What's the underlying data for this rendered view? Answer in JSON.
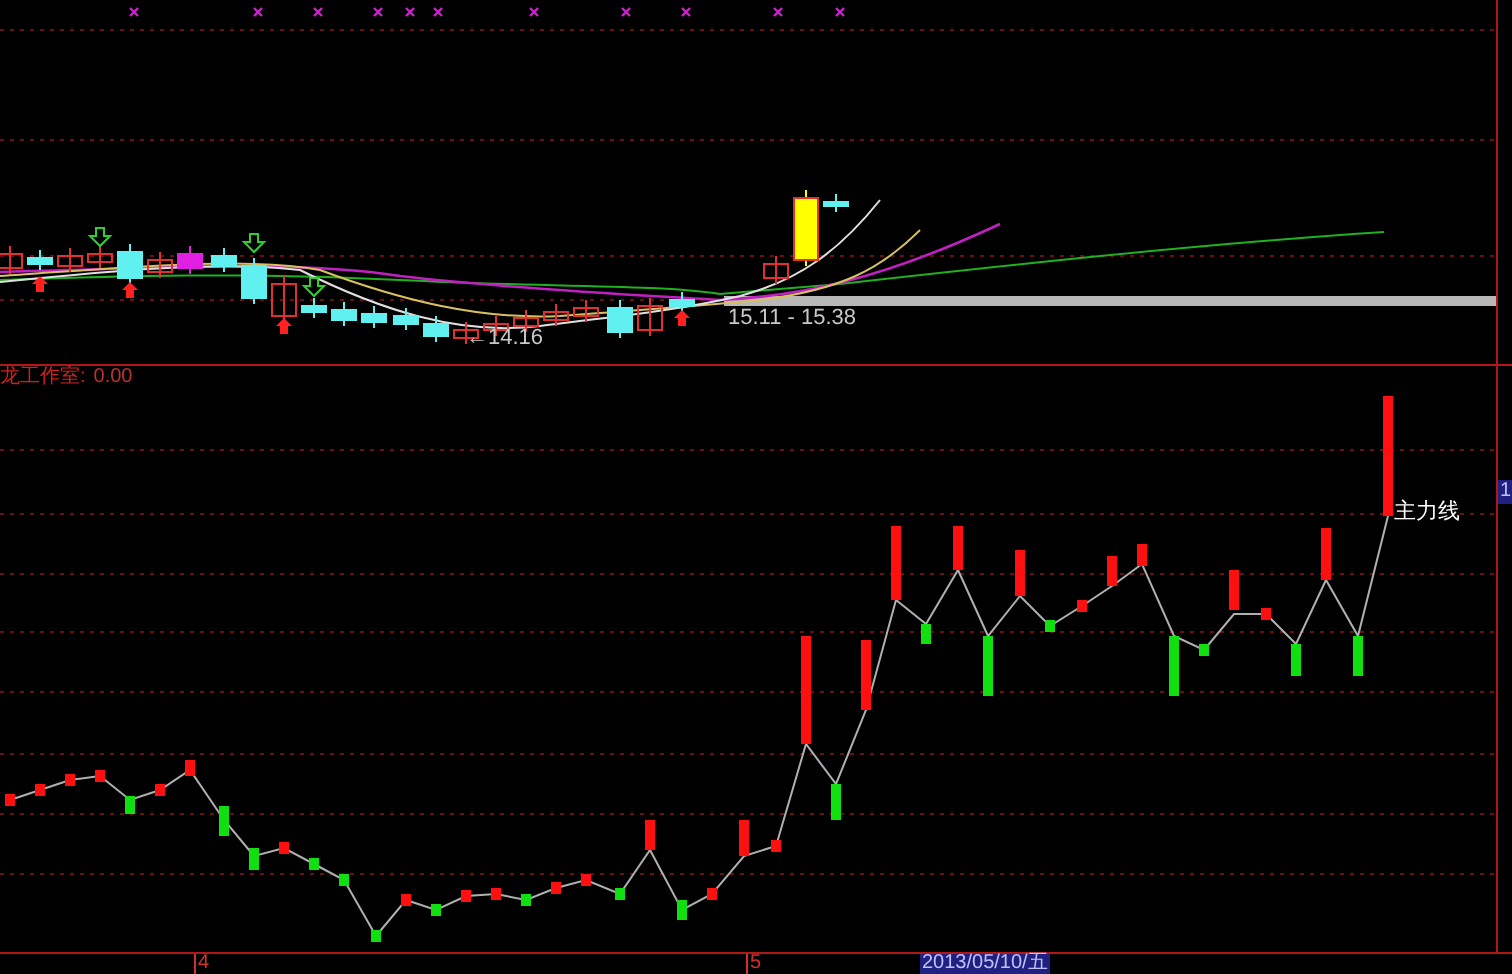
{
  "price_panel": {
    "range_label": "15.11 - 15.38",
    "low_label": "←14.16"
  },
  "indicator_panel": {
    "title": "龙工作室:",
    "value": "0.00",
    "line_label": "主力线",
    "axis_badge": "1"
  },
  "time_axis": {
    "ticks": [
      "4",
      "5"
    ],
    "cursor_date": "2013/05/10/五"
  }
}
